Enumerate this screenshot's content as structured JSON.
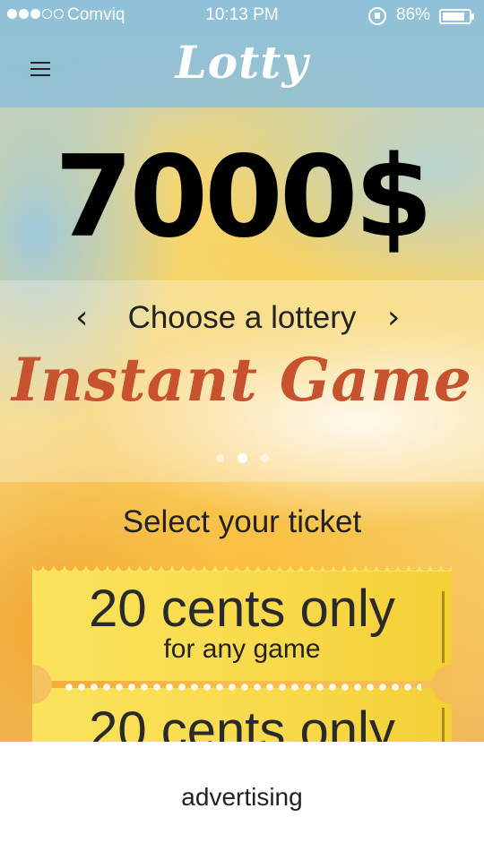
{
  "status_bar": {
    "carrier": "Comviq",
    "time": "10:13 PM",
    "battery_percent": "86%",
    "battery_level": 0.86,
    "signal_bars": 3,
    "signal_max": 5
  },
  "nav": {
    "logo": "Lotty",
    "menu_icon": "hamburger-menu-icon"
  },
  "jackpot": {
    "amount": "7000$"
  },
  "lottery_chooser": {
    "prev_arrow": "‹",
    "label": "Choose a lottery",
    "next_arrow": "›",
    "current_game": "Instant Game",
    "page_count": 3,
    "active_page": 2
  },
  "tickets": {
    "heading": "Select your ticket",
    "items": [
      {
        "price": "20 cents only",
        "subtitle": "for any game"
      },
      {
        "price": "20 cents only",
        "subtitle": ""
      }
    ]
  },
  "advertising": {
    "label": "advertising"
  },
  "colors": {
    "game_title": "#c8512e",
    "ticket": "#f8d94a",
    "bar": "#8cbed7"
  }
}
